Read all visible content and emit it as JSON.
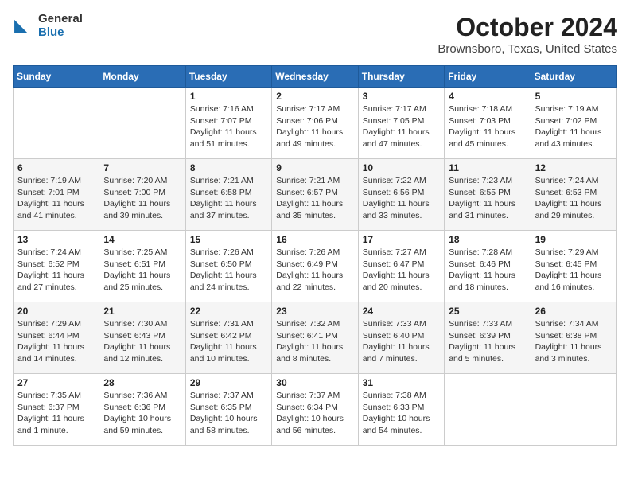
{
  "logo": {
    "general": "General",
    "blue": "Blue"
  },
  "title": "October 2024",
  "subtitle": "Brownsboro, Texas, United States",
  "days_header": [
    "Sunday",
    "Monday",
    "Tuesday",
    "Wednesday",
    "Thursday",
    "Friday",
    "Saturday"
  ],
  "weeks": [
    [
      {
        "day": "",
        "detail": ""
      },
      {
        "day": "",
        "detail": ""
      },
      {
        "day": "1",
        "detail": "Sunrise: 7:16 AM\nSunset: 7:07 PM\nDaylight: 11 hours and 51 minutes."
      },
      {
        "day": "2",
        "detail": "Sunrise: 7:17 AM\nSunset: 7:06 PM\nDaylight: 11 hours and 49 minutes."
      },
      {
        "day": "3",
        "detail": "Sunrise: 7:17 AM\nSunset: 7:05 PM\nDaylight: 11 hours and 47 minutes."
      },
      {
        "day": "4",
        "detail": "Sunrise: 7:18 AM\nSunset: 7:03 PM\nDaylight: 11 hours and 45 minutes."
      },
      {
        "day": "5",
        "detail": "Sunrise: 7:19 AM\nSunset: 7:02 PM\nDaylight: 11 hours and 43 minutes."
      }
    ],
    [
      {
        "day": "6",
        "detail": "Sunrise: 7:19 AM\nSunset: 7:01 PM\nDaylight: 11 hours and 41 minutes."
      },
      {
        "day": "7",
        "detail": "Sunrise: 7:20 AM\nSunset: 7:00 PM\nDaylight: 11 hours and 39 minutes."
      },
      {
        "day": "8",
        "detail": "Sunrise: 7:21 AM\nSunset: 6:58 PM\nDaylight: 11 hours and 37 minutes."
      },
      {
        "day": "9",
        "detail": "Sunrise: 7:21 AM\nSunset: 6:57 PM\nDaylight: 11 hours and 35 minutes."
      },
      {
        "day": "10",
        "detail": "Sunrise: 7:22 AM\nSunset: 6:56 PM\nDaylight: 11 hours and 33 minutes."
      },
      {
        "day": "11",
        "detail": "Sunrise: 7:23 AM\nSunset: 6:55 PM\nDaylight: 11 hours and 31 minutes."
      },
      {
        "day": "12",
        "detail": "Sunrise: 7:24 AM\nSunset: 6:53 PM\nDaylight: 11 hours and 29 minutes."
      }
    ],
    [
      {
        "day": "13",
        "detail": "Sunrise: 7:24 AM\nSunset: 6:52 PM\nDaylight: 11 hours and 27 minutes."
      },
      {
        "day": "14",
        "detail": "Sunrise: 7:25 AM\nSunset: 6:51 PM\nDaylight: 11 hours and 25 minutes."
      },
      {
        "day": "15",
        "detail": "Sunrise: 7:26 AM\nSunset: 6:50 PM\nDaylight: 11 hours and 24 minutes."
      },
      {
        "day": "16",
        "detail": "Sunrise: 7:26 AM\nSunset: 6:49 PM\nDaylight: 11 hours and 22 minutes."
      },
      {
        "day": "17",
        "detail": "Sunrise: 7:27 AM\nSunset: 6:47 PM\nDaylight: 11 hours and 20 minutes."
      },
      {
        "day": "18",
        "detail": "Sunrise: 7:28 AM\nSunset: 6:46 PM\nDaylight: 11 hours and 18 minutes."
      },
      {
        "day": "19",
        "detail": "Sunrise: 7:29 AM\nSunset: 6:45 PM\nDaylight: 11 hours and 16 minutes."
      }
    ],
    [
      {
        "day": "20",
        "detail": "Sunrise: 7:29 AM\nSunset: 6:44 PM\nDaylight: 11 hours and 14 minutes."
      },
      {
        "day": "21",
        "detail": "Sunrise: 7:30 AM\nSunset: 6:43 PM\nDaylight: 11 hours and 12 minutes."
      },
      {
        "day": "22",
        "detail": "Sunrise: 7:31 AM\nSunset: 6:42 PM\nDaylight: 11 hours and 10 minutes."
      },
      {
        "day": "23",
        "detail": "Sunrise: 7:32 AM\nSunset: 6:41 PM\nDaylight: 11 hours and 8 minutes."
      },
      {
        "day": "24",
        "detail": "Sunrise: 7:33 AM\nSunset: 6:40 PM\nDaylight: 11 hours and 7 minutes."
      },
      {
        "day": "25",
        "detail": "Sunrise: 7:33 AM\nSunset: 6:39 PM\nDaylight: 11 hours and 5 minutes."
      },
      {
        "day": "26",
        "detail": "Sunrise: 7:34 AM\nSunset: 6:38 PM\nDaylight: 11 hours and 3 minutes."
      }
    ],
    [
      {
        "day": "27",
        "detail": "Sunrise: 7:35 AM\nSunset: 6:37 PM\nDaylight: 11 hours and 1 minute."
      },
      {
        "day": "28",
        "detail": "Sunrise: 7:36 AM\nSunset: 6:36 PM\nDaylight: 10 hours and 59 minutes."
      },
      {
        "day": "29",
        "detail": "Sunrise: 7:37 AM\nSunset: 6:35 PM\nDaylight: 10 hours and 58 minutes."
      },
      {
        "day": "30",
        "detail": "Sunrise: 7:37 AM\nSunset: 6:34 PM\nDaylight: 10 hours and 56 minutes."
      },
      {
        "day": "31",
        "detail": "Sunrise: 7:38 AM\nSunset: 6:33 PM\nDaylight: 10 hours and 54 minutes."
      },
      {
        "day": "",
        "detail": ""
      },
      {
        "day": "",
        "detail": ""
      }
    ]
  ]
}
